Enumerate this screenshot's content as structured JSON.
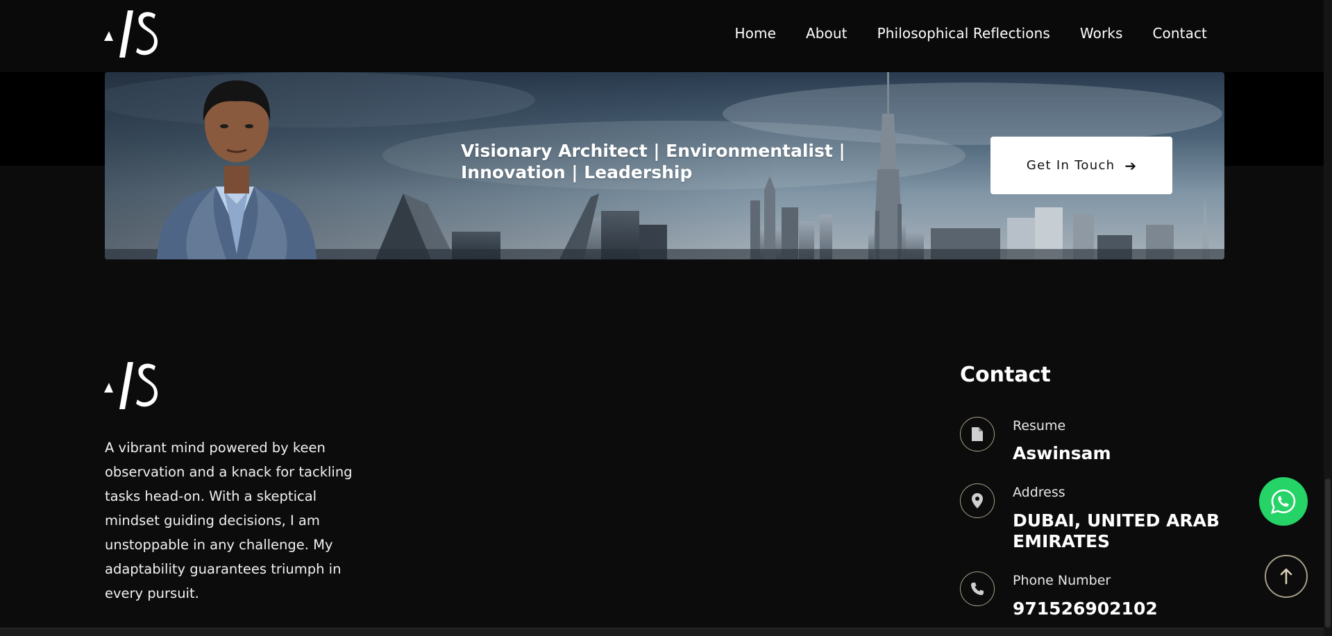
{
  "header": {
    "nav": [
      {
        "label": "Home"
      },
      {
        "label": "About"
      },
      {
        "label": "Philosophical Reflections"
      },
      {
        "label": "Works"
      },
      {
        "label": "Contact"
      }
    ]
  },
  "banner": {
    "title": "Visionary Architect | Environmentalist | Innovation | Leadership",
    "cta_label": "Get In Touch",
    "cta_icon": "arrow-right-icon"
  },
  "footer": {
    "about": "A vibrant mind powered by keen observation and a knack for tackling tasks head-on. With a skeptical mindset guiding decisions, I am unstoppable in any challenge. My adaptability guarantees triumph in every pursuit.",
    "contact_heading": "Contact",
    "contacts": [
      {
        "label": "Resume",
        "value": "Aswinsam",
        "icon": "document-icon"
      },
      {
        "label": "Address",
        "value": "DUBAI, UNITED ARAB EMIRATES",
        "icon": "location-pin-icon"
      },
      {
        "label": "Phone Number",
        "value": "971526902102",
        "icon": "phone-icon"
      }
    ]
  },
  "floating": {
    "whatsapp_icon": "whatsapp-icon",
    "scroll_top_icon": "arrow-up-icon"
  },
  "colors": {
    "background": "#0c0c0c",
    "header": "#0a0a0a",
    "accent_ring": "#a8a08a",
    "whatsapp": "#25d366"
  }
}
